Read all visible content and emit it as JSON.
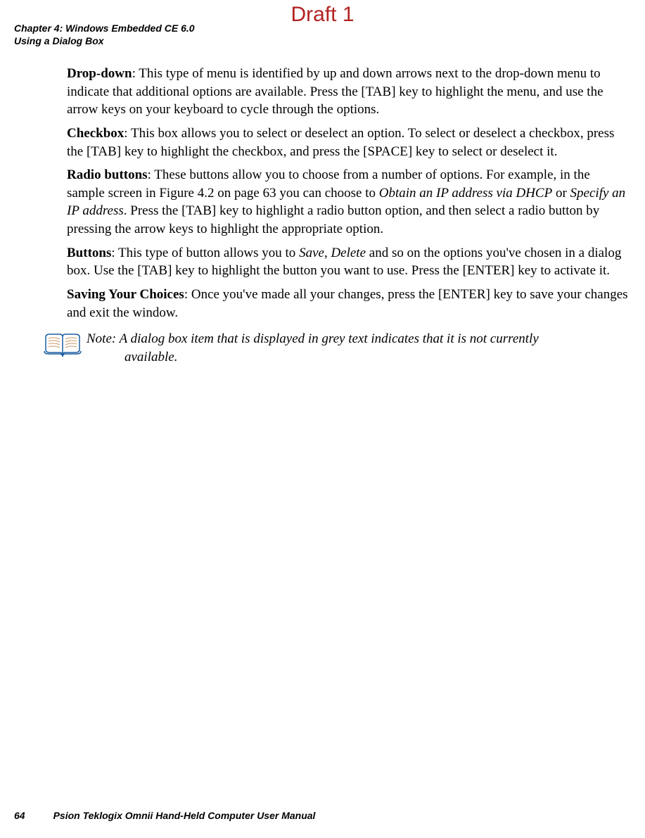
{
  "watermark": "Draft 1",
  "header": {
    "chapter": "Chapter 4:  Windows Embedded CE 6.0",
    "section": "Using a Dialog Box"
  },
  "paragraphs": {
    "dropdown": {
      "label": "Drop-down",
      "text": ": This type of menu is identified by up and down arrows next to the drop-down menu to indicate that additional options are available. Press the [TAB] key to highlight the menu, and use the arrow keys on your keyboard to cycle through the options."
    },
    "checkbox": {
      "label": "Checkbox",
      "text": ": This box allows you to select or deselect an option. To select or deselect a checkbox, press the [TAB] key to highlight the checkbox, and press the [SPACE] key to select or deselect it."
    },
    "radio": {
      "label": "Radio buttons",
      "text1": ": These buttons allow you to choose from a number of options. For example, in the sample screen in Figure 4.2 on page 63 you can choose to ",
      "italic1": "Obtain an IP address via DHCP",
      "text2": " or ",
      "italic2": "Specify an IP address",
      "text3": ". Press the [TAB] key to highlight a radio button option, and then select a radio button by pressing the arrow keys to highlight the appropriate option."
    },
    "buttons": {
      "label": "Buttons",
      "text1": ": This type of button allows you to ",
      "italic1": "Save",
      "text2": ", ",
      "italic2": "Delete",
      "text3": " and so on the options you've chosen in a dialog box. Use the [TAB] key to highlight the button you want to use. Press the [ENTER] key to activate it."
    },
    "saving": {
      "label": "Saving Your Choices",
      "text": ": Once you've made all your changes, press the [ENTER] key to save your changes and exit the window."
    }
  },
  "note": {
    "label": "Note: ",
    "line1": "A dialog box item that is displayed in grey text indicates that it is not currently",
    "line2": "available."
  },
  "footer": {
    "page": "64",
    "title": "Psion Teklogix Omnii Hand-Held Computer User Manual"
  }
}
